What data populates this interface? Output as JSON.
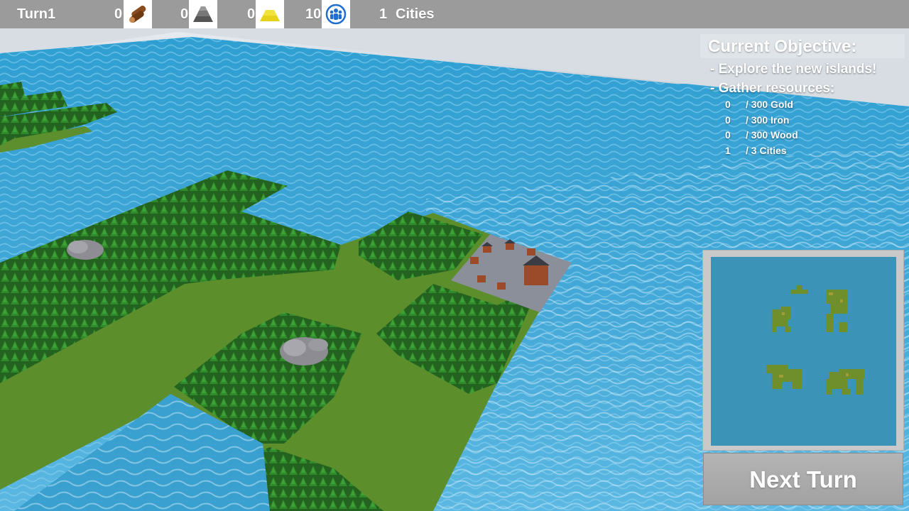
{
  "hud": {
    "turn_label": "Turn1",
    "resources": [
      {
        "name": "wood",
        "value": "0",
        "icon": "wood-logs-icon"
      },
      {
        "name": "iron",
        "value": "0",
        "icon": "iron-ingot-icon"
      },
      {
        "name": "gold",
        "value": "0",
        "icon": "gold-ingot-icon"
      },
      {
        "name": "population",
        "value": "10",
        "icon": "population-icon"
      }
    ],
    "cities_count": "1",
    "cities_label": "Cities"
  },
  "objective": {
    "title": "Current Objective:",
    "lines": [
      "- Explore the new islands!",
      "- Gather resources:"
    ],
    "goals": [
      {
        "current": "0",
        "target": "/ 300 Gold"
      },
      {
        "current": "0",
        "target": "/ 300 Iron"
      },
      {
        "current": "0",
        "target": "/ 300 Wood"
      },
      {
        "current": "1",
        "target": "/ 3 Cities"
      }
    ]
  },
  "minimap": {
    "water_color": "#3b94b8",
    "islands": 4
  },
  "next_turn": {
    "label": "Next Turn"
  },
  "colors": {
    "hud_bar": "#9b9b9b",
    "water": "#3aa6d6",
    "grass": "#5e8f2e",
    "forest": "#2f7a2a",
    "city_plaza": "#8a8f99",
    "gold": "#e6d21a",
    "population_blue": "#1f6fd1",
    "wood_brown": "#8a4b1e"
  }
}
